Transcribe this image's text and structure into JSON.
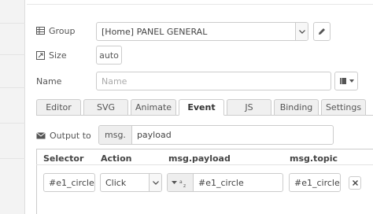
{
  "form": {
    "group": {
      "label": "Group",
      "value": "[Home] PANEL GENERAL"
    },
    "size": {
      "label": "Size",
      "value": "auto"
    },
    "name": {
      "label": "Name",
      "placeholder": "Name"
    }
  },
  "tabs": [
    {
      "label": "Editor",
      "active": false
    },
    {
      "label": "SVG",
      "active": false
    },
    {
      "label": "Animate",
      "active": false
    },
    {
      "label": "Event",
      "active": true
    },
    {
      "label": "JS",
      "active": false
    },
    {
      "label": "Binding",
      "active": false
    },
    {
      "label": "Settings",
      "active": false
    }
  ],
  "output": {
    "label": "Output to",
    "prefix": "msg.",
    "value": "payload"
  },
  "table": {
    "headers": [
      "Selector",
      "Action",
      "msg.payload",
      "msg.topic"
    ],
    "rows": [
      {
        "selector": "#e1_circle",
        "action": "Click",
        "payload": "#e1_circle",
        "topic": "#e1_circle"
      }
    ]
  },
  "icons": {
    "group": "table-icon",
    "size": "resize-icon",
    "edit": "pencil-icon",
    "name_menu": "book-icon",
    "output": "envelope-icon",
    "type": "string-type-icon",
    "delete": "close-icon"
  }
}
